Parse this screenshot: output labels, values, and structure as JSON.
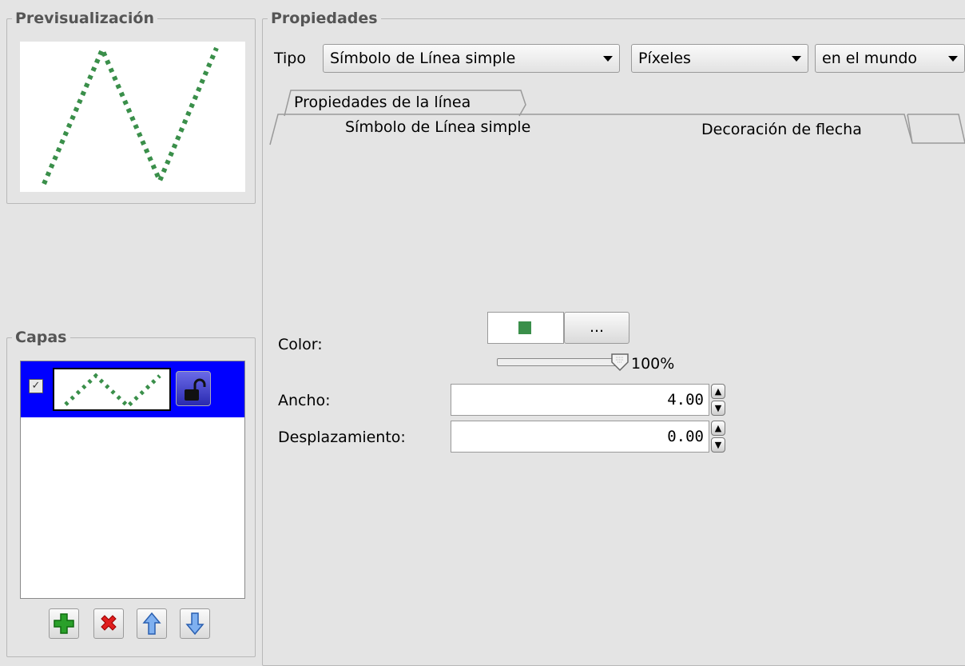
{
  "preview": {
    "title": "Previsualización",
    "line_color": "#3a8f4a"
  },
  "layers": {
    "title": "Capas",
    "items": [
      {
        "checked": true,
        "selected": true,
        "lock_icon": "unlock-icon"
      }
    ],
    "selection_color": "#0000ff",
    "buttons": [
      {
        "icon": "add-icon",
        "color": "#2aa02a"
      },
      {
        "icon": "remove-icon",
        "color": "#e01e1e"
      },
      {
        "icon": "up-arrow-icon",
        "color": "#4a7fd0"
      },
      {
        "icon": "down-arrow-icon",
        "color": "#4a7fd0"
      }
    ]
  },
  "properties": {
    "title": "Propiedades",
    "type_label": "Tipo",
    "type_value": "Símbolo de Línea simple",
    "unit_value": "Píxeles",
    "scope_value": "en el mundo",
    "outer_tab": "Propiedades de la línea",
    "tabs": [
      "Símbolo de Línea simple",
      "Decoración de flecha"
    ],
    "color_label": "Color:",
    "color_value": "#3a8f4a",
    "color_button": "...",
    "opacity": "100%",
    "width_label": "Ancho:",
    "width_value": "4.00",
    "offset_label": "Desplazamiento:",
    "offset_value": "0.00"
  }
}
